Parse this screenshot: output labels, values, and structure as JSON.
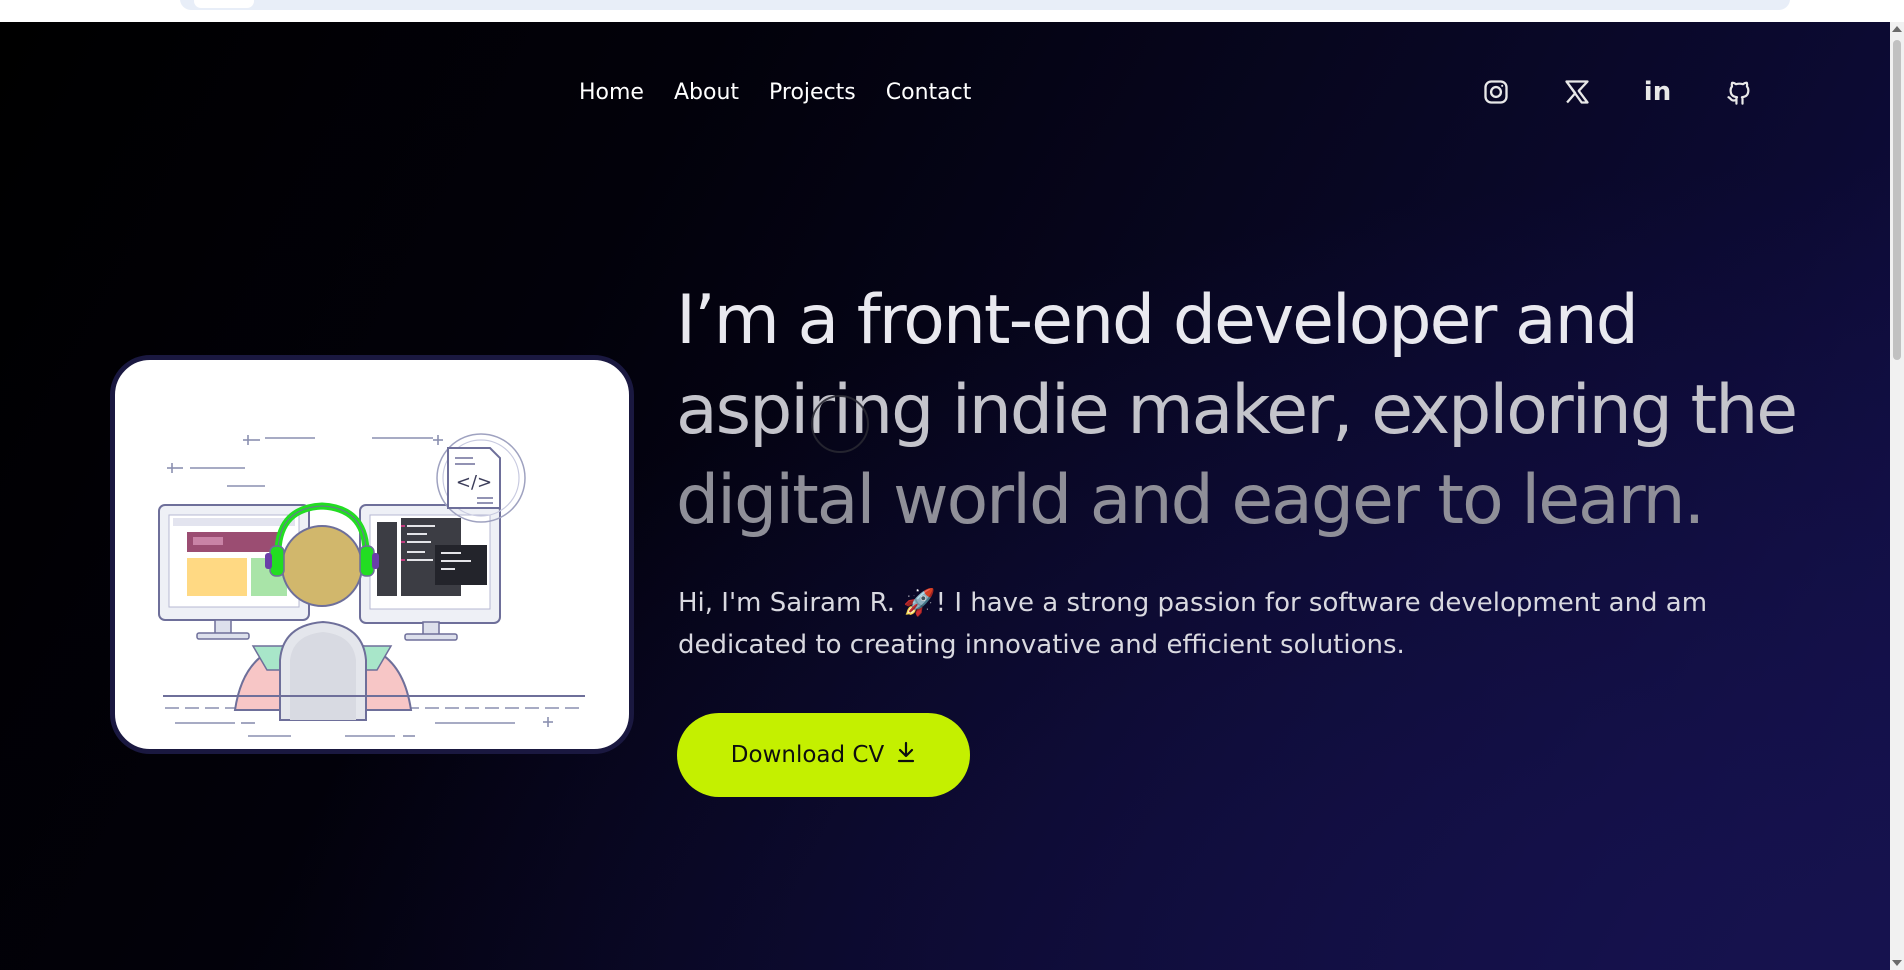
{
  "nav": {
    "items": [
      {
        "label": "Home"
      },
      {
        "label": "About"
      },
      {
        "label": "Projects"
      },
      {
        "label": "Contact"
      }
    ]
  },
  "socials": [
    {
      "icon": "instagram-icon"
    },
    {
      "icon": "x-twitter-icon"
    },
    {
      "icon": "linkedin-icon",
      "text": "in"
    },
    {
      "icon": "github-icon"
    }
  ],
  "hero": {
    "headline_line1": "I’m a front-end developer and",
    "headline_line2": "aspiring indie maker, exploring the",
    "headline_line3": "digital world and eager to learn.",
    "intro_line1": "Hi, I'm Sairam R. 🚀! I have a strong passion for software development and am",
    "intro_line2": "dedicated to creating innovative and efficient solutions.",
    "cta_label": "Download CV",
    "cta_icon": "download-icon"
  },
  "illustration": {
    "code_tag": "</>"
  },
  "colors": {
    "accent": "#c4f000",
    "background_dark": "#000000",
    "background_navy": "#13104a",
    "headset": "#22dd22"
  }
}
